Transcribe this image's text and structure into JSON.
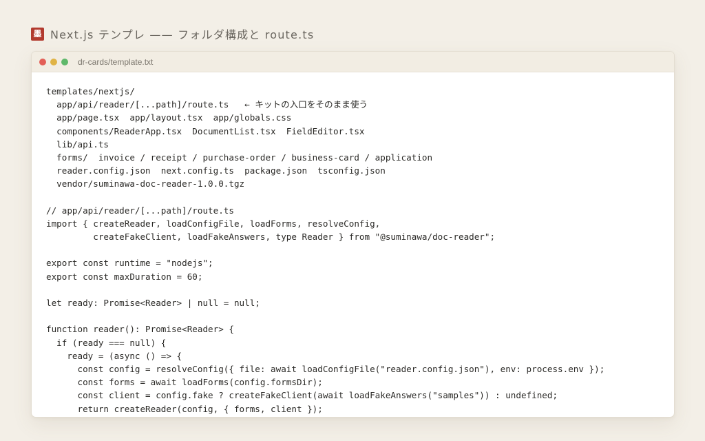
{
  "header": {
    "logo_glyph": "墨",
    "title": "Next.js テンプレ —— フォルダ構成と route.ts"
  },
  "window": {
    "filename": "dr-cards/template.txt",
    "traffic_lights": [
      "close",
      "minimize",
      "zoom"
    ]
  },
  "code_lines": [
    "templates/nextjs/",
    "  app/api/reader/[...path]/route.ts   ← キットの入口をそのまま使う",
    "  app/page.tsx  app/layout.tsx  app/globals.css",
    "  components/ReaderApp.tsx  DocumentList.tsx  FieldEditor.tsx",
    "  lib/api.ts",
    "  forms/  invoice / receipt / purchase-order / business-card / application",
    "  reader.config.json  next.config.ts  package.json  tsconfig.json",
    "  vendor/suminawa-doc-reader-1.0.0.tgz",
    "",
    "// app/api/reader/[...path]/route.ts",
    "import { createReader, loadConfigFile, loadForms, resolveConfig,",
    "         createFakeClient, loadFakeAnswers, type Reader } from \"@suminawa/doc-reader\";",
    "",
    "export const runtime = \"nodejs\";",
    "export const maxDuration = 60;",
    "",
    "let ready: Promise<Reader> | null = null;",
    "",
    "function reader(): Promise<Reader> {",
    "  if (ready === null) {",
    "    ready = (async () => {",
    "      const config = resolveConfig({ file: await loadConfigFile(\"reader.config.json\"), env: process.env });",
    "      const forms = await loadForms(config.formsDir);",
    "      const client = config.fake ? createFakeClient(await loadFakeAnswers(\"samples\")) : undefined;",
    "      return createReader(config, { forms, client });"
  ]
}
